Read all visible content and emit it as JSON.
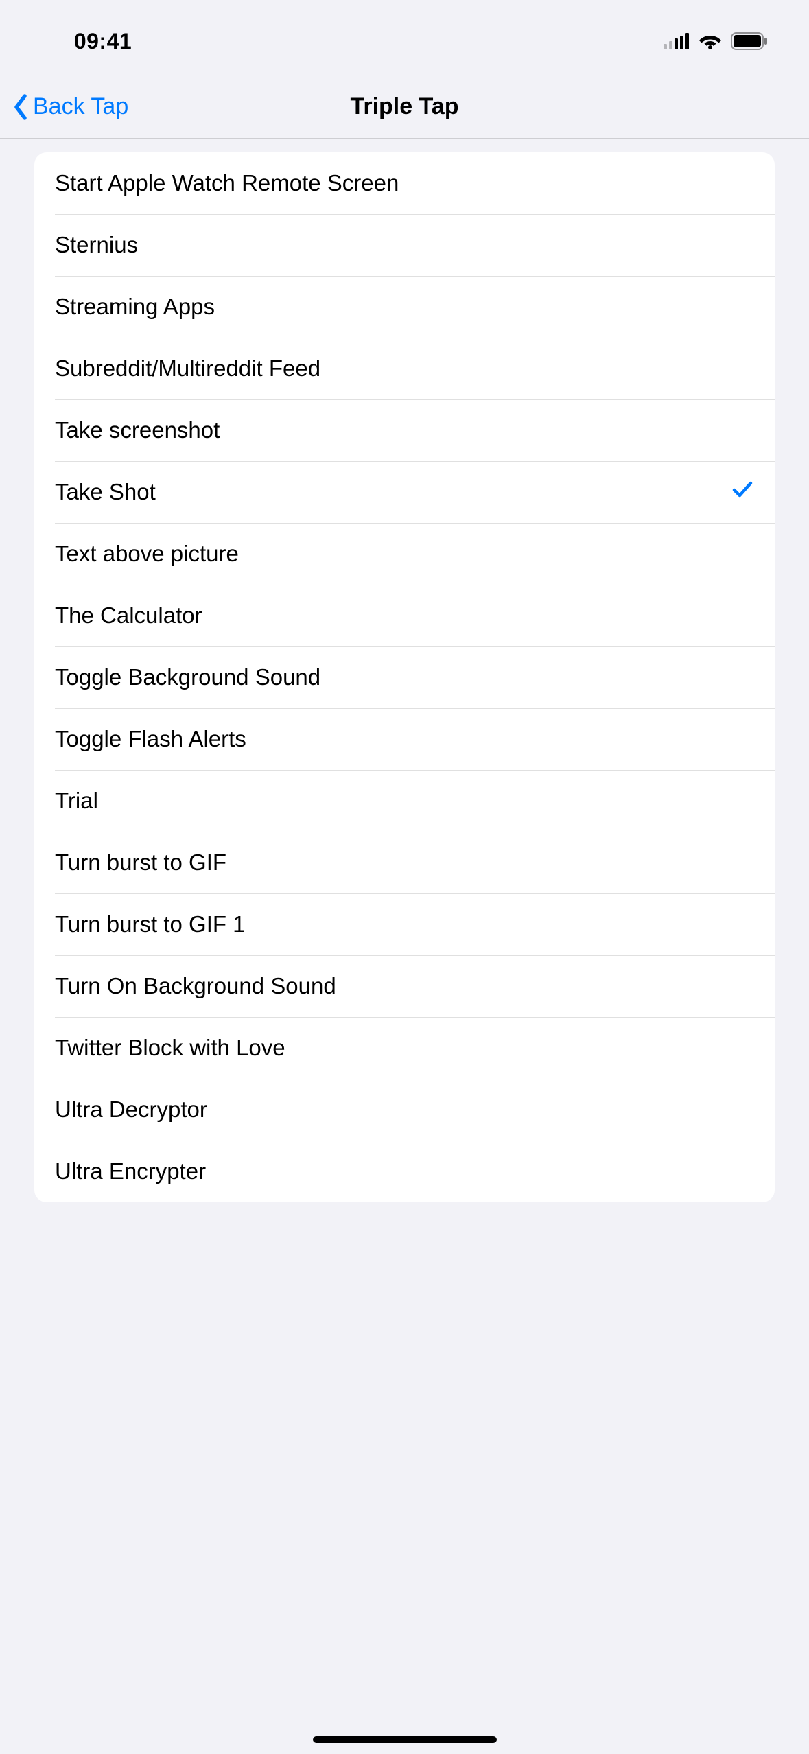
{
  "status": {
    "time": "09:41"
  },
  "nav": {
    "back_label": "Back Tap",
    "title": "Triple Tap"
  },
  "selected_index": 5,
  "items": [
    {
      "label": "Start Apple Watch Remote Screen"
    },
    {
      "label": "Sternius"
    },
    {
      "label": "Streaming Apps"
    },
    {
      "label": "Subreddit/Multireddit Feed"
    },
    {
      "label": "Take screenshot"
    },
    {
      "label": "Take Shot"
    },
    {
      "label": "Text above picture"
    },
    {
      "label": "The Calculator"
    },
    {
      "label": "Toggle Background Sound"
    },
    {
      "label": "Toggle Flash Alerts"
    },
    {
      "label": "Trial"
    },
    {
      "label": "Turn burst to GIF"
    },
    {
      "label": "Turn burst to GIF 1"
    },
    {
      "label": "Turn On Background Sound"
    },
    {
      "label": "Twitter Block with Love"
    },
    {
      "label": "Ultra Decryptor"
    },
    {
      "label": "Ultra Encrypter"
    }
  ]
}
